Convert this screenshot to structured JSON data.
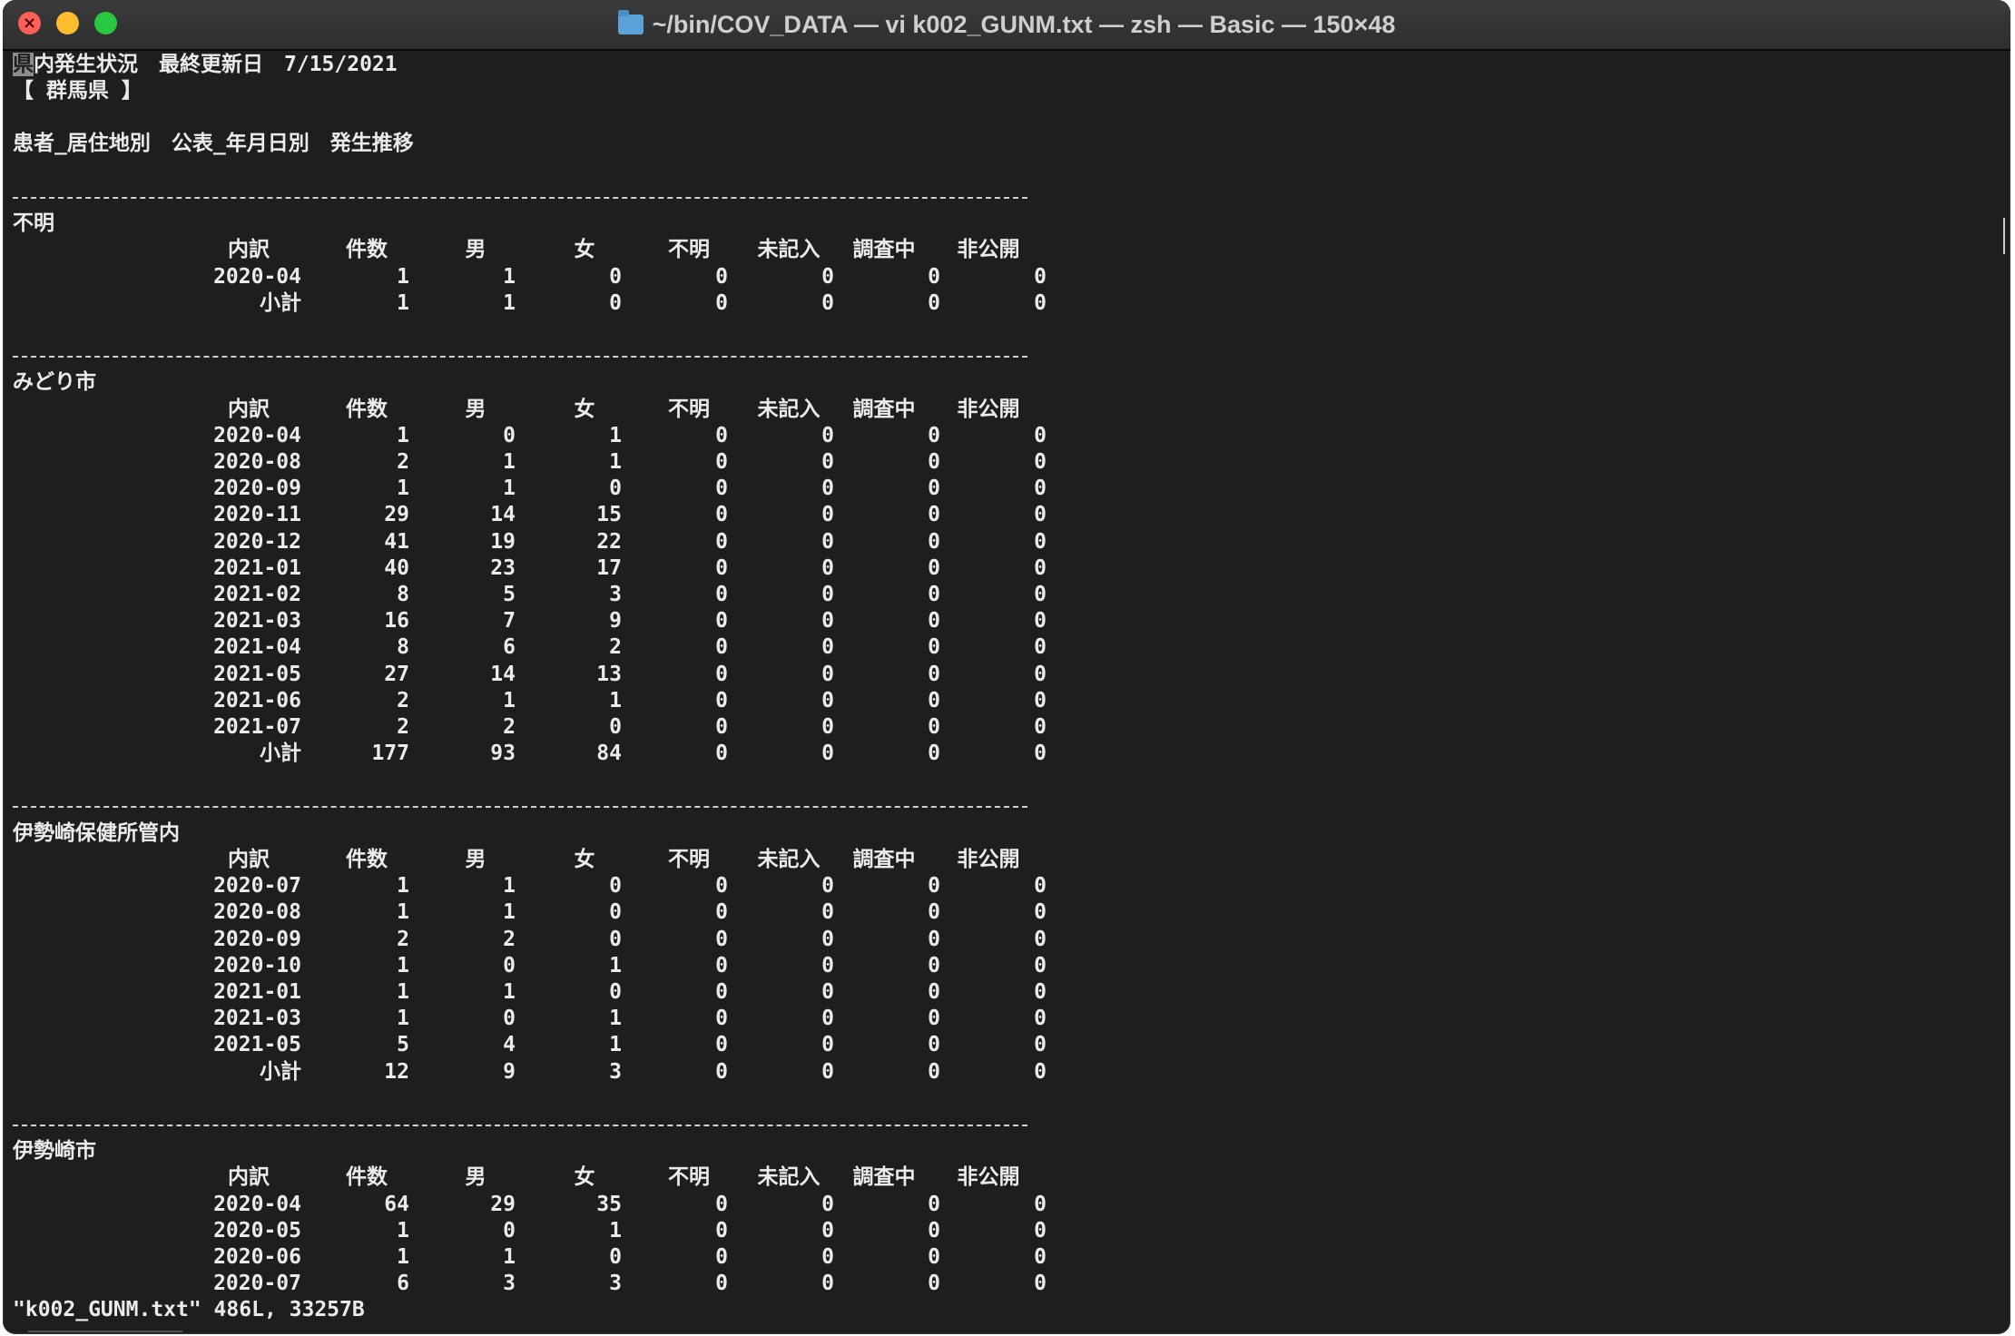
{
  "window": {
    "title": "~/bin/COV_DATA — vi k002_GUNM.txt — zsh — Basic — 150×48",
    "folder_icon": "folder-icon"
  },
  "header": {
    "line1_first_char": "県",
    "line1_rest": "内発生状況　最終更新日　7/15/2021",
    "line2": "【 群馬県 】",
    "line3": "患者_居住地別　公表_年月日別　発生推移"
  },
  "columns": [
    "内訳",
    "件数",
    "男",
    "女",
    "不明",
    "未記入",
    "調査中",
    "非公開"
  ],
  "sections": [
    {
      "name": "不明",
      "rows": [
        [
          "2020-04",
          "1",
          "1",
          "0",
          "0",
          "0",
          "0",
          "0"
        ],
        [
          "小計",
          "1",
          "1",
          "0",
          "0",
          "0",
          "0",
          "0"
        ]
      ]
    },
    {
      "name": "みどり市",
      "rows": [
        [
          "2020-04",
          "1",
          "0",
          "1",
          "0",
          "0",
          "0",
          "0"
        ],
        [
          "2020-08",
          "2",
          "1",
          "1",
          "0",
          "0",
          "0",
          "0"
        ],
        [
          "2020-09",
          "1",
          "1",
          "0",
          "0",
          "0",
          "0",
          "0"
        ],
        [
          "2020-11",
          "29",
          "14",
          "15",
          "0",
          "0",
          "0",
          "0"
        ],
        [
          "2020-12",
          "41",
          "19",
          "22",
          "0",
          "0",
          "0",
          "0"
        ],
        [
          "2021-01",
          "40",
          "23",
          "17",
          "0",
          "0",
          "0",
          "0"
        ],
        [
          "2021-02",
          "8",
          "5",
          "3",
          "0",
          "0",
          "0",
          "0"
        ],
        [
          "2021-03",
          "16",
          "7",
          "9",
          "0",
          "0",
          "0",
          "0"
        ],
        [
          "2021-04",
          "8",
          "6",
          "2",
          "0",
          "0",
          "0",
          "0"
        ],
        [
          "2021-05",
          "27",
          "14",
          "13",
          "0",
          "0",
          "0",
          "0"
        ],
        [
          "2021-06",
          "2",
          "1",
          "1",
          "0",
          "0",
          "0",
          "0"
        ],
        [
          "2021-07",
          "2",
          "2",
          "0",
          "0",
          "0",
          "0",
          "0"
        ],
        [
          "小計",
          "177",
          "93",
          "84",
          "0",
          "0",
          "0",
          "0"
        ]
      ]
    },
    {
      "name": "伊勢崎保健所管内",
      "rows": [
        [
          "2020-07",
          "1",
          "1",
          "0",
          "0",
          "0",
          "0",
          "0"
        ],
        [
          "2020-08",
          "1",
          "1",
          "0",
          "0",
          "0",
          "0",
          "0"
        ],
        [
          "2020-09",
          "2",
          "2",
          "0",
          "0",
          "0",
          "0",
          "0"
        ],
        [
          "2020-10",
          "1",
          "0",
          "1",
          "0",
          "0",
          "0",
          "0"
        ],
        [
          "2021-01",
          "1",
          "1",
          "0",
          "0",
          "0",
          "0",
          "0"
        ],
        [
          "2021-03",
          "1",
          "0",
          "1",
          "0",
          "0",
          "0",
          "0"
        ],
        [
          "2021-05",
          "5",
          "4",
          "1",
          "0",
          "0",
          "0",
          "0"
        ],
        [
          "小計",
          "12",
          "9",
          "3",
          "0",
          "0",
          "0",
          "0"
        ]
      ]
    },
    {
      "name": "伊勢崎市",
      "rows": [
        [
          "2020-04",
          "64",
          "29",
          "35",
          "0",
          "0",
          "0",
          "0"
        ],
        [
          "2020-05",
          "1",
          "0",
          "1",
          "0",
          "0",
          "0",
          "0"
        ],
        [
          "2020-06",
          "1",
          "1",
          "0",
          "0",
          "0",
          "0",
          "0"
        ],
        [
          "2020-07",
          "6",
          "3",
          "3",
          "0",
          "0",
          "0",
          "0"
        ]
      ]
    }
  ],
  "status_line": "\"k002_GUNM.txt\" 486L, 33257B"
}
